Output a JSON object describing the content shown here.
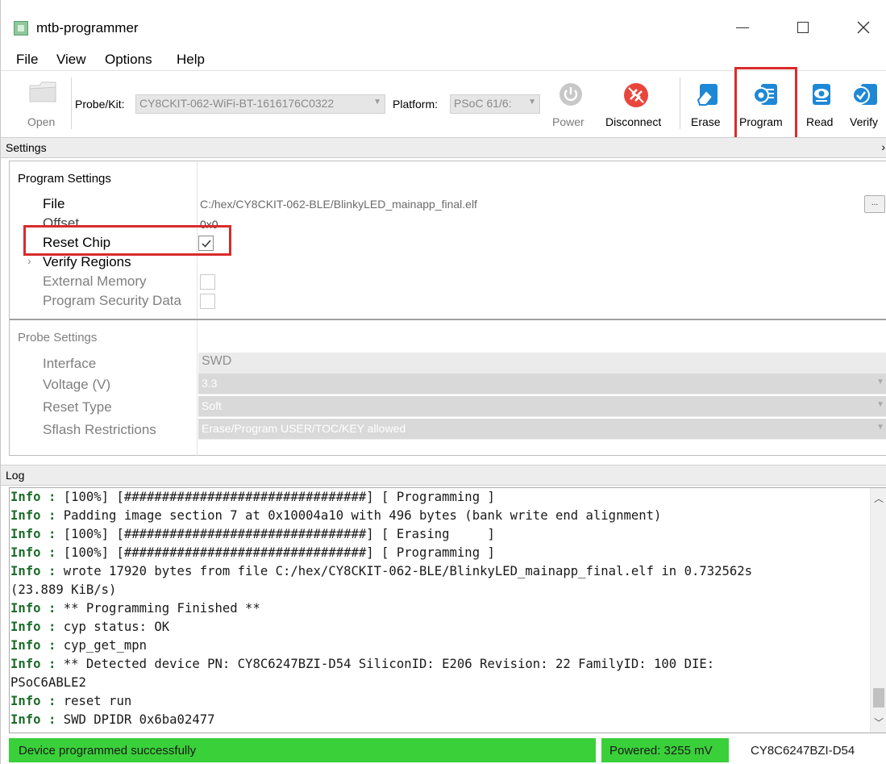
{
  "window": {
    "title": "mtb-programmer"
  },
  "menu": {
    "file": "File",
    "view": "View",
    "options": "Options",
    "help": "Help"
  },
  "toolbar": {
    "open_label": "Open",
    "probe_label": "Probe/Kit:",
    "probe_value": "CY8CKIT-062-WiFi-BT-1616176C0322",
    "platform_label": "Platform:",
    "platform_value": "PSoC 61/6:",
    "power_label": "Power",
    "disconnect_label": "Disconnect",
    "erase_label": "Erase",
    "program_label": "Program",
    "read_label": "Read",
    "verify_label": "Verify"
  },
  "settings": {
    "header": "Settings",
    "collapse_glyph": "›",
    "program_settings": {
      "title": "Program Settings",
      "file_label": "File",
      "file_value": "C:/hex/CY8CKIT-062-BLE/BlinkyLED_mainapp_final.elf",
      "browse_label": "...",
      "offset_label": "Offset",
      "offset_value": "0x0",
      "reset_chip_label": "Reset Chip",
      "reset_chip_checked": true,
      "verify_regions_label": "Verify Regions",
      "external_memory_label": "External Memory",
      "program_security_label": "Program Security Data"
    },
    "probe_settings": {
      "title": "Probe Settings",
      "interface_label": "Interface",
      "interface_value": "SWD",
      "voltage_label": "Voltage (V)",
      "voltage_value": "3.3",
      "reset_type_label": "Reset Type",
      "reset_type_value": "Soft",
      "sflash_label": "Sflash Restrictions",
      "sflash_value": "Erase/Program USER/TOC/KEY allowed"
    }
  },
  "log": {
    "header": "Log",
    "lines": [
      {
        "level": "Info :",
        "text": " [100%] [################################] [ Programming ]"
      },
      {
        "level": "Info :",
        "text": " Padding image section 7 at 0x10004a10 with 496 bytes (bank write end alignment)"
      },
      {
        "level": "Info :",
        "text": " [100%] [################################] [ Erasing     ]"
      },
      {
        "level": "Info :",
        "text": " [100%] [################################] [ Programming ]"
      },
      {
        "level": "Info :",
        "text": " wrote 17920 bytes from file C:/hex/CY8CKIT-062-BLE/BlinkyLED_mainapp_final.elf in 0.732562s"
      },
      {
        "level": "",
        "text": "(23.889 KiB/s)"
      },
      {
        "level": "Info :",
        "text": " ** Programming Finished **"
      },
      {
        "level": "Info :",
        "text": " cyp status: OK"
      },
      {
        "level": "Info :",
        "text": " cyp_get_mpn"
      },
      {
        "level": "Info :",
        "text": " ** Detected device PN: CY8C6247BZI-D54 SiliconID: E206 Revision: 22 FamilyID: 100 DIE:"
      },
      {
        "level": "",
        "text": "PSoC6ABLE2"
      },
      {
        "level": "Info :",
        "text": " reset run"
      },
      {
        "level": "Info :",
        "text": " SWD DPIDR 0x6ba02477"
      }
    ]
  },
  "status": {
    "message": "Device programmed successfully",
    "power": "Powered: 3255 mV",
    "device": "CY8C6247BZI-D54"
  },
  "colors": {
    "status_green": "#3ad03a",
    "highlight_red": "#d92b2b",
    "log_level_green": "#1d6b2a",
    "disconnect_red": "#e8463d",
    "action_blue": "#1e88d6"
  }
}
